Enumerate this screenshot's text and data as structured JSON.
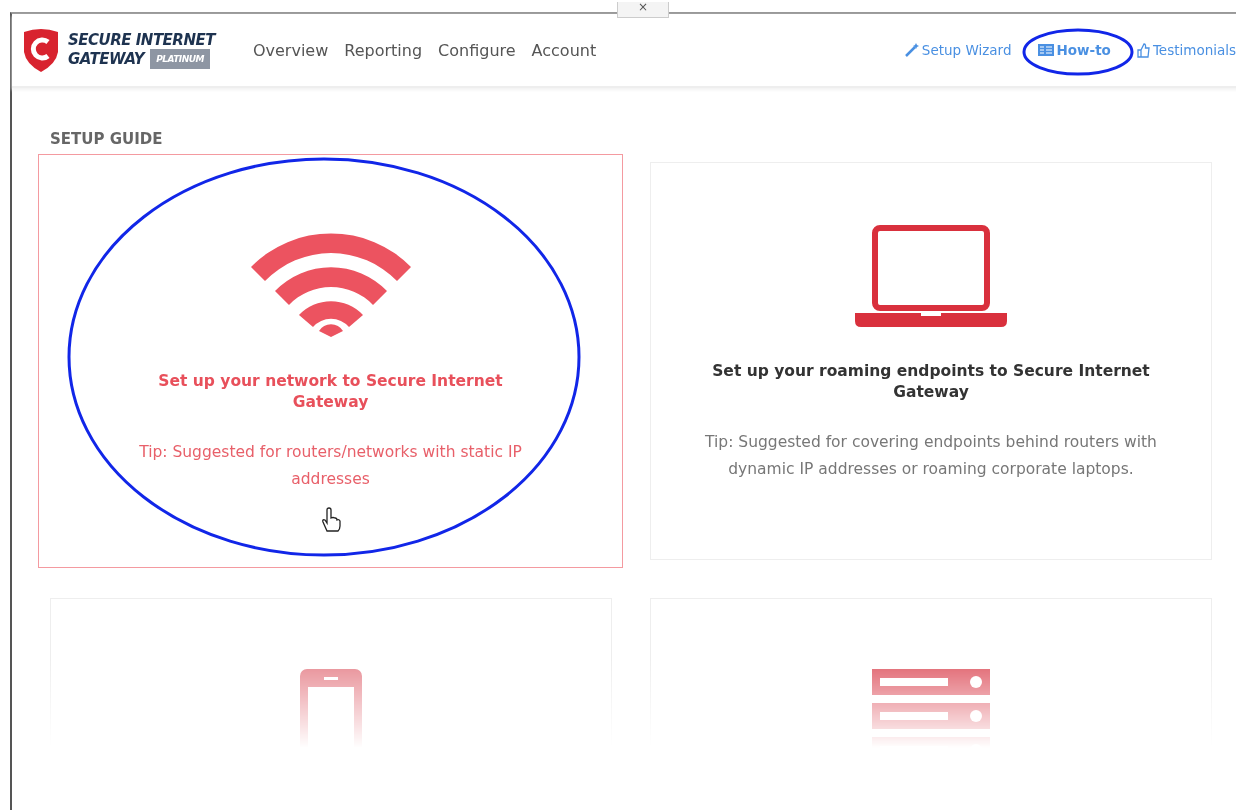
{
  "window": {
    "close": "×"
  },
  "brand": {
    "line1": "SECURE INTERNET",
    "line2": "GATEWAY",
    "edition": "PLATINUM"
  },
  "nav": [
    {
      "label": "Overview"
    },
    {
      "label": "Reporting"
    },
    {
      "label": "Configure"
    },
    {
      "label": "Account"
    }
  ],
  "links": [
    {
      "label": "Setup Wizard",
      "kind": "wand",
      "highlighted": false,
      "bold": false
    },
    {
      "label": "How-to",
      "kind": "list",
      "highlighted": true,
      "bold": true
    },
    {
      "label": "Testimonials",
      "kind": "thumb",
      "highlighted": false,
      "bold": false
    }
  ],
  "section_title": "SETUP GUIDE",
  "cards": [
    {
      "kind": "wifi",
      "title": "Set up your network to Secure Internet Gateway",
      "tip": "Tip: Suggested for routers/networks with static IP addresses",
      "selected": true,
      "highlighted": true
    },
    {
      "kind": "laptop",
      "title": "Set up your roaming endpoints to Secure Internet Gateway",
      "tip": "Tip: Suggested for covering endpoints behind routers with dynamic IP addresses or roaming corporate laptops.",
      "selected": false,
      "highlighted": false
    },
    {
      "kind": "phone",
      "selected": false,
      "highlighted": false
    },
    {
      "kind": "server",
      "selected": false,
      "highlighted": false
    }
  ]
}
